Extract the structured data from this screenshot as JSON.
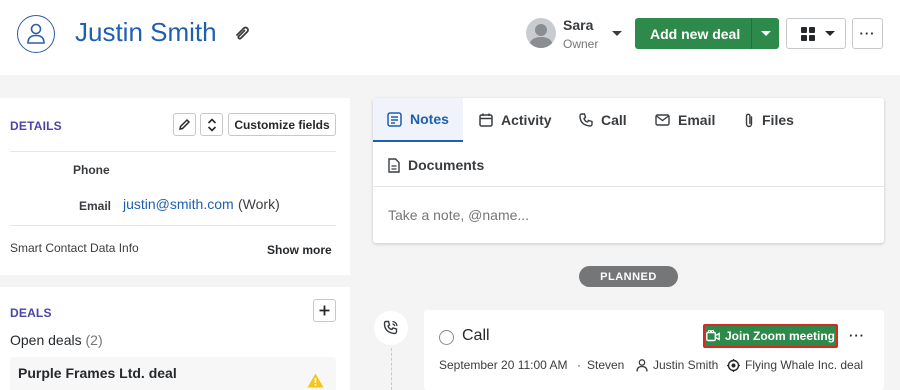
{
  "person": {
    "name": "Justin Smith"
  },
  "owner": {
    "name": "Sara",
    "role": "Owner"
  },
  "header": {
    "add_deal_label": "Add new deal",
    "more_label": "···"
  },
  "details": {
    "title": "DETAILS",
    "customize_label": "Customize fields",
    "phone_label": "Phone",
    "email_label": "Email",
    "email_value": "justin@smith.com",
    "email_type": "(Work)",
    "smart_info": "Smart Contact Data Info",
    "show_more": "Show more"
  },
  "deals": {
    "title": "DEALS",
    "open_label": "Open deals",
    "open_count": "(2)",
    "items": [
      {
        "name": "Purple Frames Ltd. deal"
      }
    ]
  },
  "composer": {
    "tabs": [
      {
        "label": "Notes",
        "icon": "notes-icon",
        "active": true
      },
      {
        "label": "Activity",
        "icon": "calendar-icon"
      },
      {
        "label": "Call",
        "icon": "phone-icon"
      },
      {
        "label": "Email",
        "icon": "envelope-icon"
      },
      {
        "label": "Files",
        "icon": "paperclip-icon"
      },
      {
        "label": "Documents",
        "icon": "document-icon"
      }
    ],
    "placeholder": "Take a note, @name..."
  },
  "timeline": {
    "planned_label": "PLANNED",
    "activity": {
      "title": "Call",
      "zoom_label": "Join Zoom meeting",
      "date": "September 20 11:00 AM",
      "separator": "·",
      "assignee": "Steven",
      "person": "Justin Smith",
      "deal": "Flying Whale Inc. deal",
      "more_label": "···"
    }
  },
  "colors": {
    "brand_blue": "#1f5fb0",
    "primary_green": "#2d8a4a",
    "section_purple": "#4a45a8",
    "highlight_red": "#d42a21",
    "warning_yellow": "#f5c518"
  }
}
